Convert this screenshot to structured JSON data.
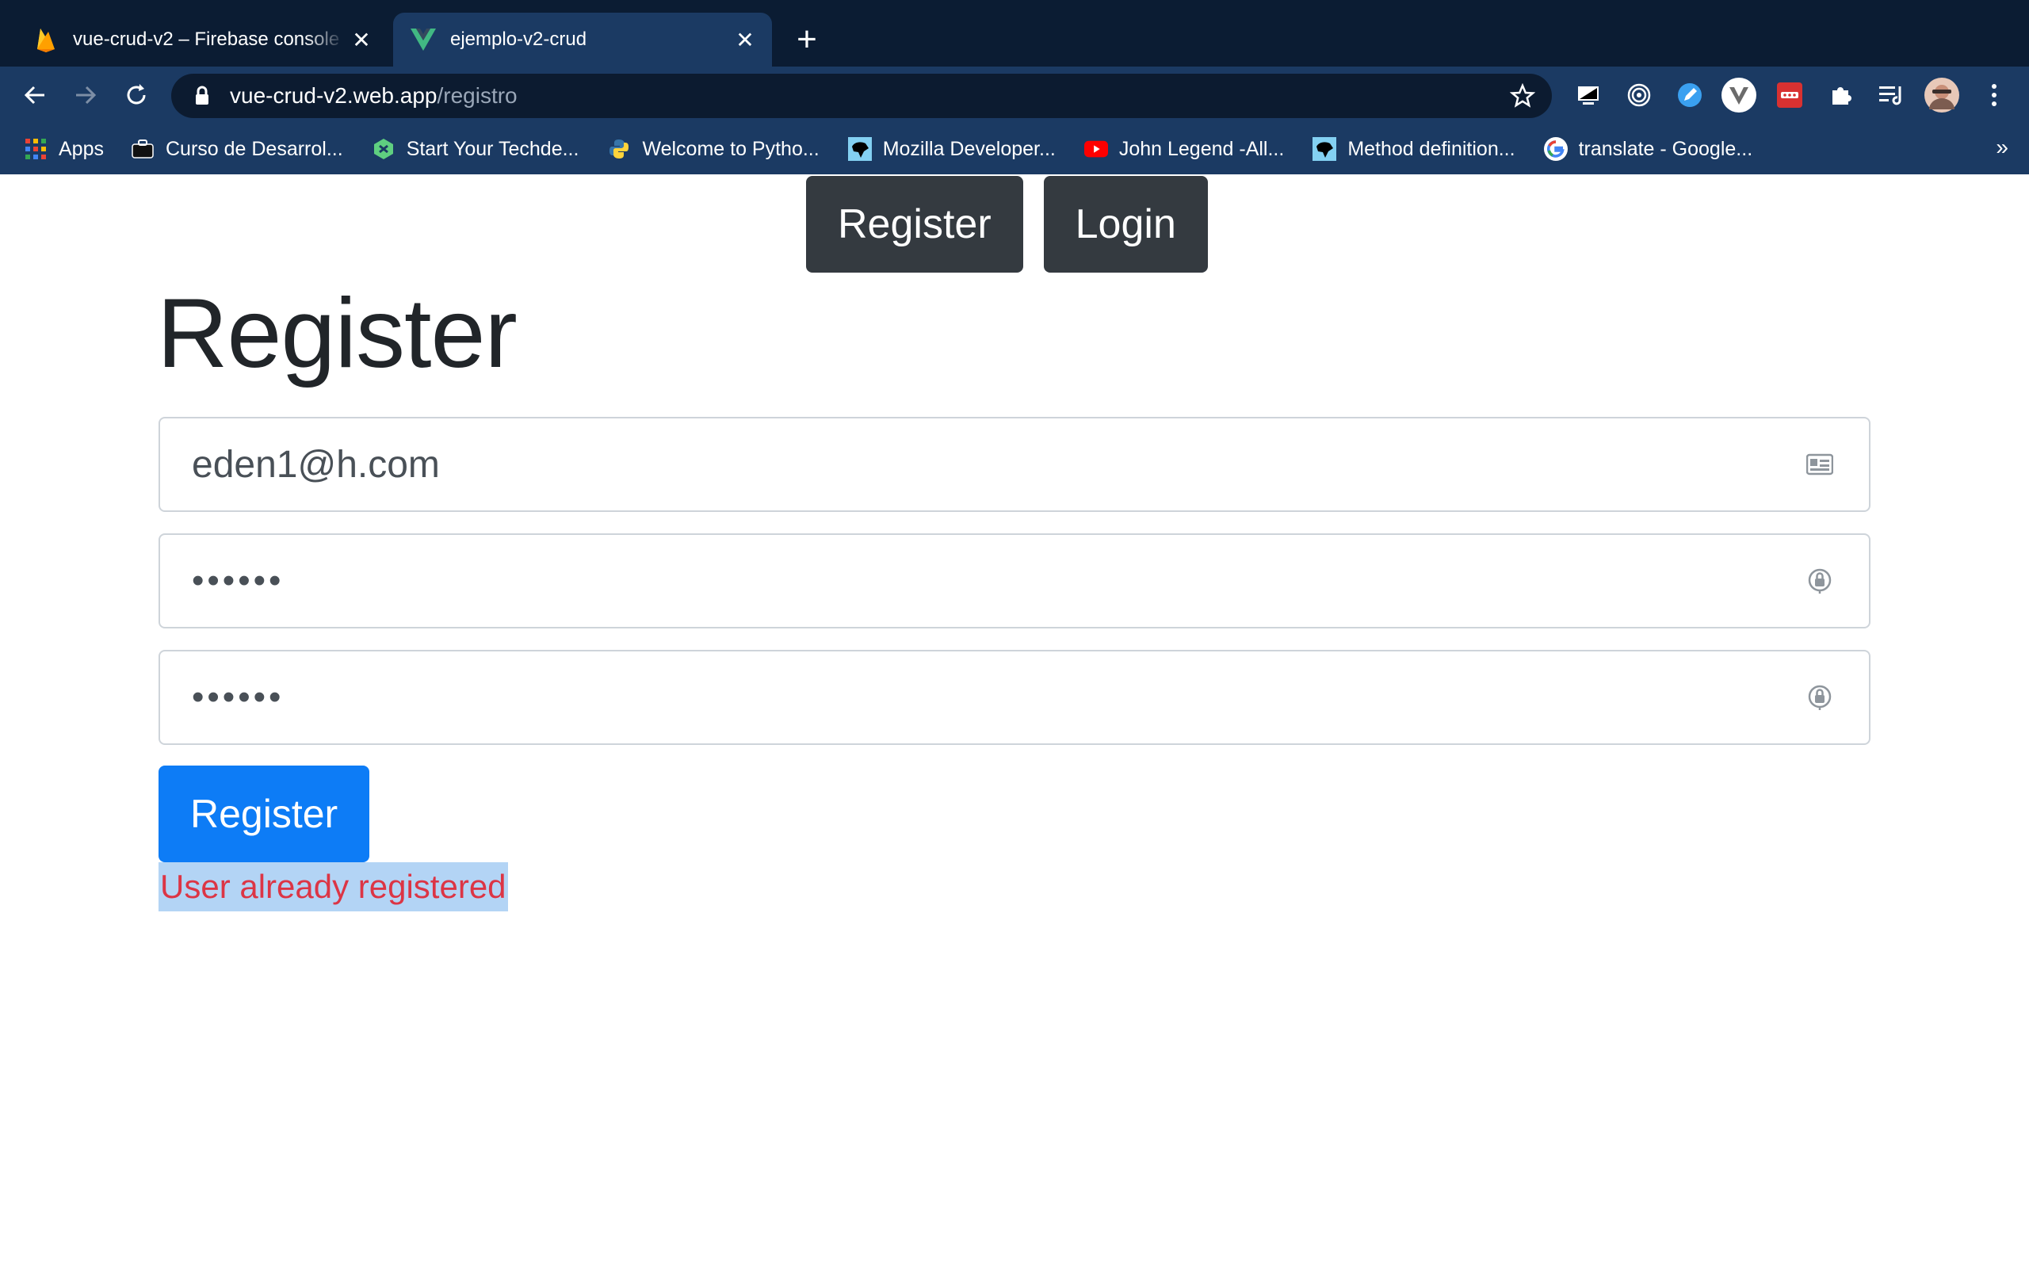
{
  "browser": {
    "tabs": [
      {
        "title": "vue-crud-v2 – Firebase console",
        "favicon": "firebase-icon",
        "active": false
      },
      {
        "title": "ejemplo-v2-crud",
        "favicon": "vue-icon",
        "active": true
      }
    ],
    "address": {
      "host": "vue-crud-v2.web.app",
      "path": "/registro"
    },
    "bookmarks": [
      {
        "label": "Apps",
        "icon": "apps-grid-icon"
      },
      {
        "label": "Curso de Desarrol...",
        "icon": "suitcase-icon"
      },
      {
        "label": "Start Your Techde...",
        "icon": "techdegree-icon"
      },
      {
        "label": "Welcome to Pytho...",
        "icon": "python-icon"
      },
      {
        "label": "Mozilla Developer...",
        "icon": "mdn-icon"
      },
      {
        "label": "John Legend -All...",
        "icon": "youtube-icon"
      },
      {
        "label": "Method definition...",
        "icon": "mdn-icon"
      },
      {
        "label": "translate - Google...",
        "icon": "google-icon"
      }
    ],
    "bookmarks_overflow": "»"
  },
  "nav": {
    "register": "Register",
    "login": "Login"
  },
  "form": {
    "heading": "Register",
    "email": "eden1@h.com",
    "password_mask": "••••••",
    "confirm_mask": "••••••",
    "submit": "Register",
    "error": "User already registered"
  },
  "colors": {
    "primary": "#0d7cf6",
    "dark": "#343a40",
    "danger": "#dc3545",
    "selection": "#b3d4f5"
  }
}
